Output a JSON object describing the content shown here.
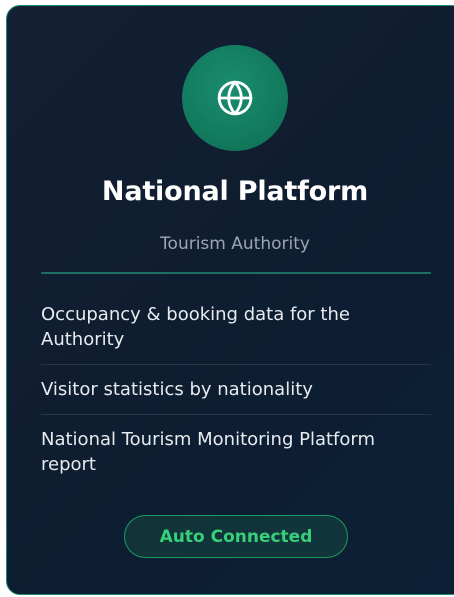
{
  "card": {
    "icon": "globe-icon",
    "title": "National Platform",
    "subtitle": "Tourism Authority",
    "features": [
      "Occupancy & booking data for the Authority",
      "Visitor statistics by nationality",
      "National Tourism Monitoring Platform report"
    ],
    "status_label": "Auto Connected"
  },
  "colors": {
    "card_background": "#121f33",
    "card_border": "#1f8a70",
    "icon_circle": "#137a5e",
    "divider": "#1c6f62",
    "status_text": "#37d07a",
    "status_border": "#1f9a5e"
  }
}
